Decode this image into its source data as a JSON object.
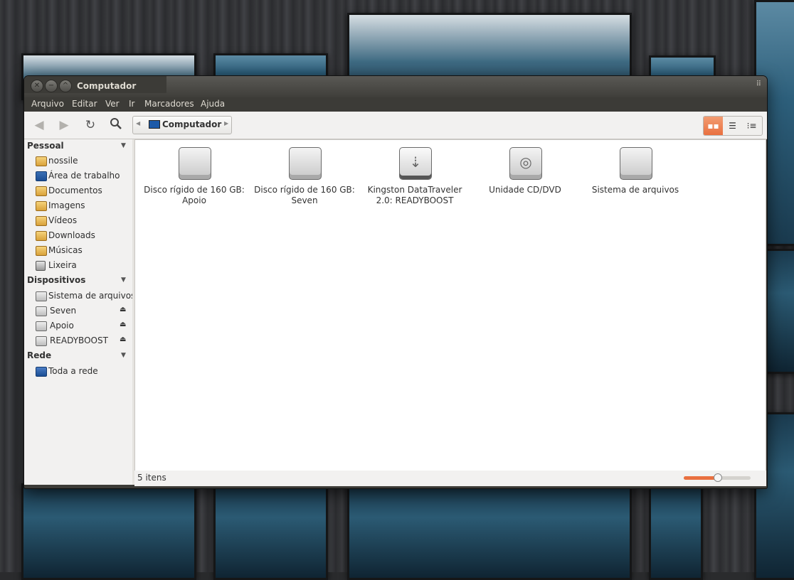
{
  "window": {
    "title": "Computador"
  },
  "menu": [
    "Arquivo",
    "Editar",
    "Ver",
    "Ir",
    "Marcadores",
    "Ajuda"
  ],
  "toolbar": {
    "breadcrumb": "Computador"
  },
  "sidebar": {
    "sections": [
      {
        "title": "Pessoal",
        "items": [
          {
            "label": "nossile",
            "icon": "home-folder-icon"
          },
          {
            "label": "Área de trabalho",
            "icon": "desktop-icon"
          },
          {
            "label": "Documentos",
            "icon": "documents-folder-icon"
          },
          {
            "label": "Imagens",
            "icon": "pictures-folder-icon"
          },
          {
            "label": "Vídeos",
            "icon": "videos-folder-icon"
          },
          {
            "label": "Downloads",
            "icon": "downloads-folder-icon"
          },
          {
            "label": "Músicas",
            "icon": "music-folder-icon"
          },
          {
            "label": "Lixeira",
            "icon": "trash-icon"
          }
        ]
      },
      {
        "title": "Dispositivos",
        "items": [
          {
            "label": "Sistema de arquivos",
            "icon": "drive-icon"
          },
          {
            "label": "Seven",
            "icon": "drive-icon",
            "eject": true
          },
          {
            "label": "Apoio",
            "icon": "drive-icon",
            "eject": true
          },
          {
            "label": "READYBOOST",
            "icon": "usb-drive-icon",
            "eject": true
          }
        ]
      },
      {
        "title": "Rede",
        "items": [
          {
            "label": "Toda a rede",
            "icon": "network-icon"
          }
        ]
      }
    ]
  },
  "files": [
    {
      "label": "Disco rígido de 160 GB: Apoio",
      "icon": "hard-drive-icon"
    },
    {
      "label": "Disco rígido de 160 GB: Seven",
      "icon": "hard-drive-icon"
    },
    {
      "label": "Kingston DataTraveler 2.0: READYBOOST",
      "icon": "usb-drive-icon"
    },
    {
      "label": "Unidade CD/DVD",
      "icon": "optical-drive-icon"
    },
    {
      "label": "Sistema de arquivos",
      "icon": "hard-drive-icon"
    }
  ],
  "status": {
    "count": "5 itens",
    "zoom_level": 0.5
  },
  "colors": {
    "accent": "#e9703f",
    "titlebar": "#3c3b37",
    "sidebar_bg": "#f2f1f0"
  }
}
